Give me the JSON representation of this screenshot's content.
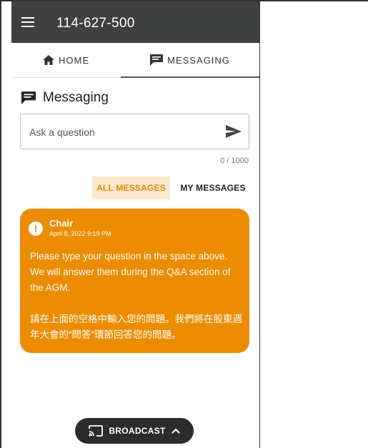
{
  "header": {
    "title": "114-627-500"
  },
  "tabs": [
    {
      "label": "HOME",
      "icon": "home-icon"
    },
    {
      "label": "MESSAGING",
      "icon": "chat-icon"
    }
  ],
  "messaging": {
    "title": "Messaging",
    "placeholder": "Ask a question",
    "counter": "0 / 1000",
    "filters": {
      "all": "ALL MESSAGES",
      "mine": "MY MESSAGES"
    }
  },
  "messages": [
    {
      "author": "Chair",
      "time": "April 8, 2022 9:19 PM",
      "text_en": "Please type your question in the space above. We will answer them during the Q&A section of the AGM.",
      "text_zh": "請在上面的空格中輸入您的問題。我們將在股東週年大會的“問答”環節回答您的問題。"
    }
  ],
  "broadcast": {
    "label": "BROADCAST"
  },
  "colors": {
    "topbar": "#3f4140",
    "accent": "#ec8c00",
    "filter_active_bg": "#fde9cf",
    "broadcast_bg": "#2c2c2c"
  }
}
